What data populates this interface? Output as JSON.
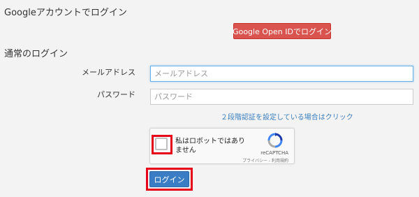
{
  "google_section": {
    "title": "Googleアカウントでログイン",
    "button_label": "Google Open IDでログイン"
  },
  "normal_section": {
    "title": "通常のログイン",
    "email": {
      "label": "メールアドレス",
      "placeholder": "メールアドレス",
      "value": ""
    },
    "password": {
      "label": "パスワード",
      "placeholder": "パスワード",
      "value": ""
    },
    "two_step_link": "２段階認証を設定している場合はクリック"
  },
  "captcha": {
    "label": "私はロボットではありません",
    "brand": "reCAPTCHA",
    "privacy": "プライバシー - 利用規約",
    "checked": false,
    "icon": "recaptcha-logo-icon"
  },
  "login_button_label": "ログイン",
  "colors": {
    "google_button": "#d9534f",
    "login_button": "#3b7dc4",
    "link": "#3b7fbf",
    "highlight": "#e6001a",
    "background": "#f3f3f3"
  }
}
